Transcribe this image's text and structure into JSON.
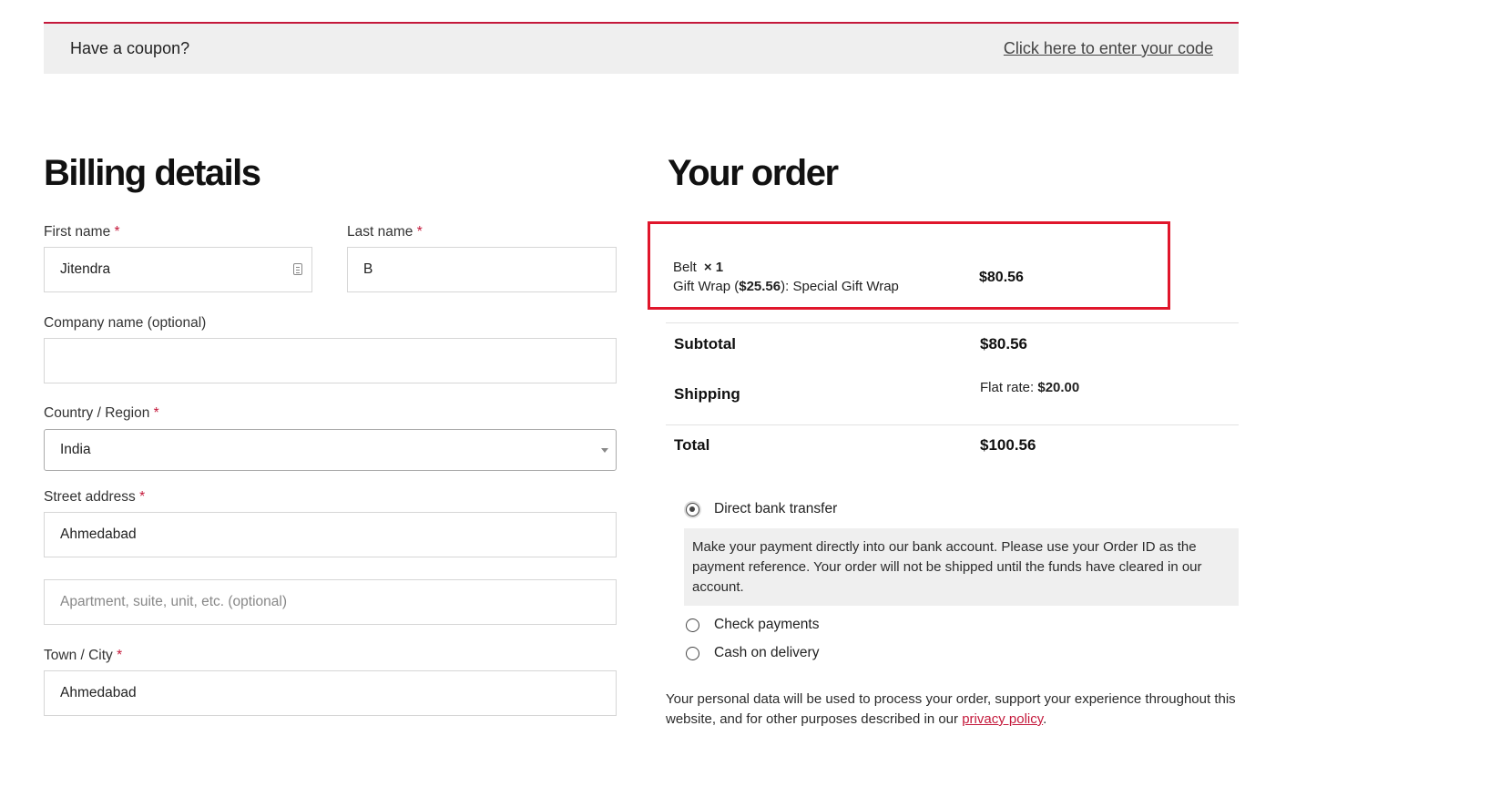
{
  "coupon": {
    "text": "Have a coupon?",
    "link": "Click here to enter your code"
  },
  "billing": {
    "title": "Billing details",
    "required_marker": "*",
    "first_name": {
      "label": "First name",
      "value": "Jitendra"
    },
    "last_name": {
      "label": "Last name",
      "value": "B"
    },
    "company": {
      "label": "Company name (optional)",
      "value": ""
    },
    "country": {
      "label": "Country / Region",
      "value": "India"
    },
    "street": {
      "label": "Street address",
      "value": "Ahmedabad"
    },
    "apartment": {
      "placeholder": "Apartment, suite, unit, etc. (optional)"
    },
    "city": {
      "label": "Town / City",
      "value": "Ahmedabad"
    }
  },
  "order": {
    "title": "Your order",
    "item": {
      "name": "Belt",
      "qty": "× 1",
      "addon_label": "Gift Wrap (",
      "addon_price": "$25.56",
      "addon_suffix": "):",
      "addon_value": "Special Gift Wrap",
      "price": "$80.56"
    },
    "subtotal": {
      "label": "Subtotal",
      "value": "$80.56"
    },
    "shipping": {
      "label": "Shipping",
      "method": "Flat rate:",
      "value": "$20.00"
    },
    "total": {
      "label": "Total",
      "value": "$100.56"
    }
  },
  "payment": {
    "methods": [
      {
        "label": "Direct bank transfer",
        "selected": true
      },
      {
        "label": "Check payments",
        "selected": false
      },
      {
        "label": "Cash on delivery",
        "selected": false
      }
    ],
    "description": "Make your payment directly into our bank account. Please use your Order ID as the payment reference. Your order will not be shipped until the funds have cleared in our account."
  },
  "privacy": {
    "text": "Your personal data will be used to process your order, support your experience throughout this website, and for other purposes described in our",
    "link": "privacy policy",
    "end": "."
  },
  "colors": {
    "accent": "#c4193b",
    "highlight": "#e0162b",
    "panel": "#efefef"
  }
}
